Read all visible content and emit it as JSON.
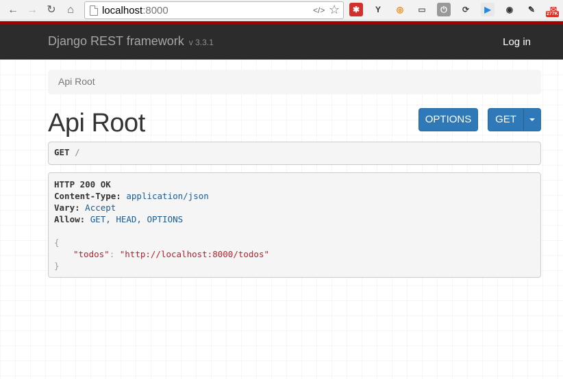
{
  "browser": {
    "url_host": "localhost",
    "url_port": ":8000",
    "nav": {
      "back_icon": "←",
      "forward_icon": "→",
      "reload_icon": "↻",
      "home_icon": "⌂"
    },
    "omnibox_icons": {
      "code": "</>",
      "star": "☆"
    },
    "extensions": [
      {
        "name": "lastpass",
        "glyph": "✱",
        "bg": "#d0312d",
        "fg": "#fff"
      },
      {
        "name": "yc",
        "glyph": "Y",
        "bg": "transparent",
        "fg": "#333"
      },
      {
        "name": "swirl",
        "glyph": "◎",
        "bg": "transparent",
        "fg": "#f57c00"
      },
      {
        "name": "cast",
        "glyph": "▭",
        "bg": "transparent",
        "fg": "#666"
      },
      {
        "name": "power",
        "glyph": "⏻",
        "bg": "#999",
        "fg": "#fff"
      },
      {
        "name": "sync",
        "glyph": "⟳",
        "bg": "transparent",
        "fg": "#444"
      },
      {
        "name": "play",
        "glyph": "▶",
        "bg": "#e8e8e8",
        "fg": "#1e88e5"
      },
      {
        "name": "aperture",
        "glyph": "◉",
        "bg": "transparent",
        "fg": "#333"
      },
      {
        "name": "eyedropper",
        "glyph": "✎",
        "bg": "transparent",
        "fg": "#333"
      },
      {
        "name": "gmail",
        "glyph": "✉",
        "bg": "transparent",
        "fg": "#d93025",
        "badge": "277K"
      }
    ]
  },
  "navbar": {
    "brand": "Django REST framework",
    "version": "v 3.3.1",
    "login": "Log in"
  },
  "breadcrumb": "Api Root",
  "title": "Api Root",
  "buttons": {
    "options": "OPTIONS",
    "get": "GET"
  },
  "request": {
    "method": "GET",
    "path": "/"
  },
  "response": {
    "status": "HTTP 200 OK",
    "headers": [
      {
        "key": "Content-Type:",
        "value": "application/json"
      },
      {
        "key": "Vary:",
        "value": "Accept"
      },
      {
        "key": "Allow:",
        "value": "GET, HEAD, OPTIONS"
      }
    ],
    "open_brace": "{",
    "json_key": "\"todos\"",
    "json_colon": ": ",
    "json_value": "\"http://localhost:8000/todos\"",
    "close_brace": "}"
  }
}
